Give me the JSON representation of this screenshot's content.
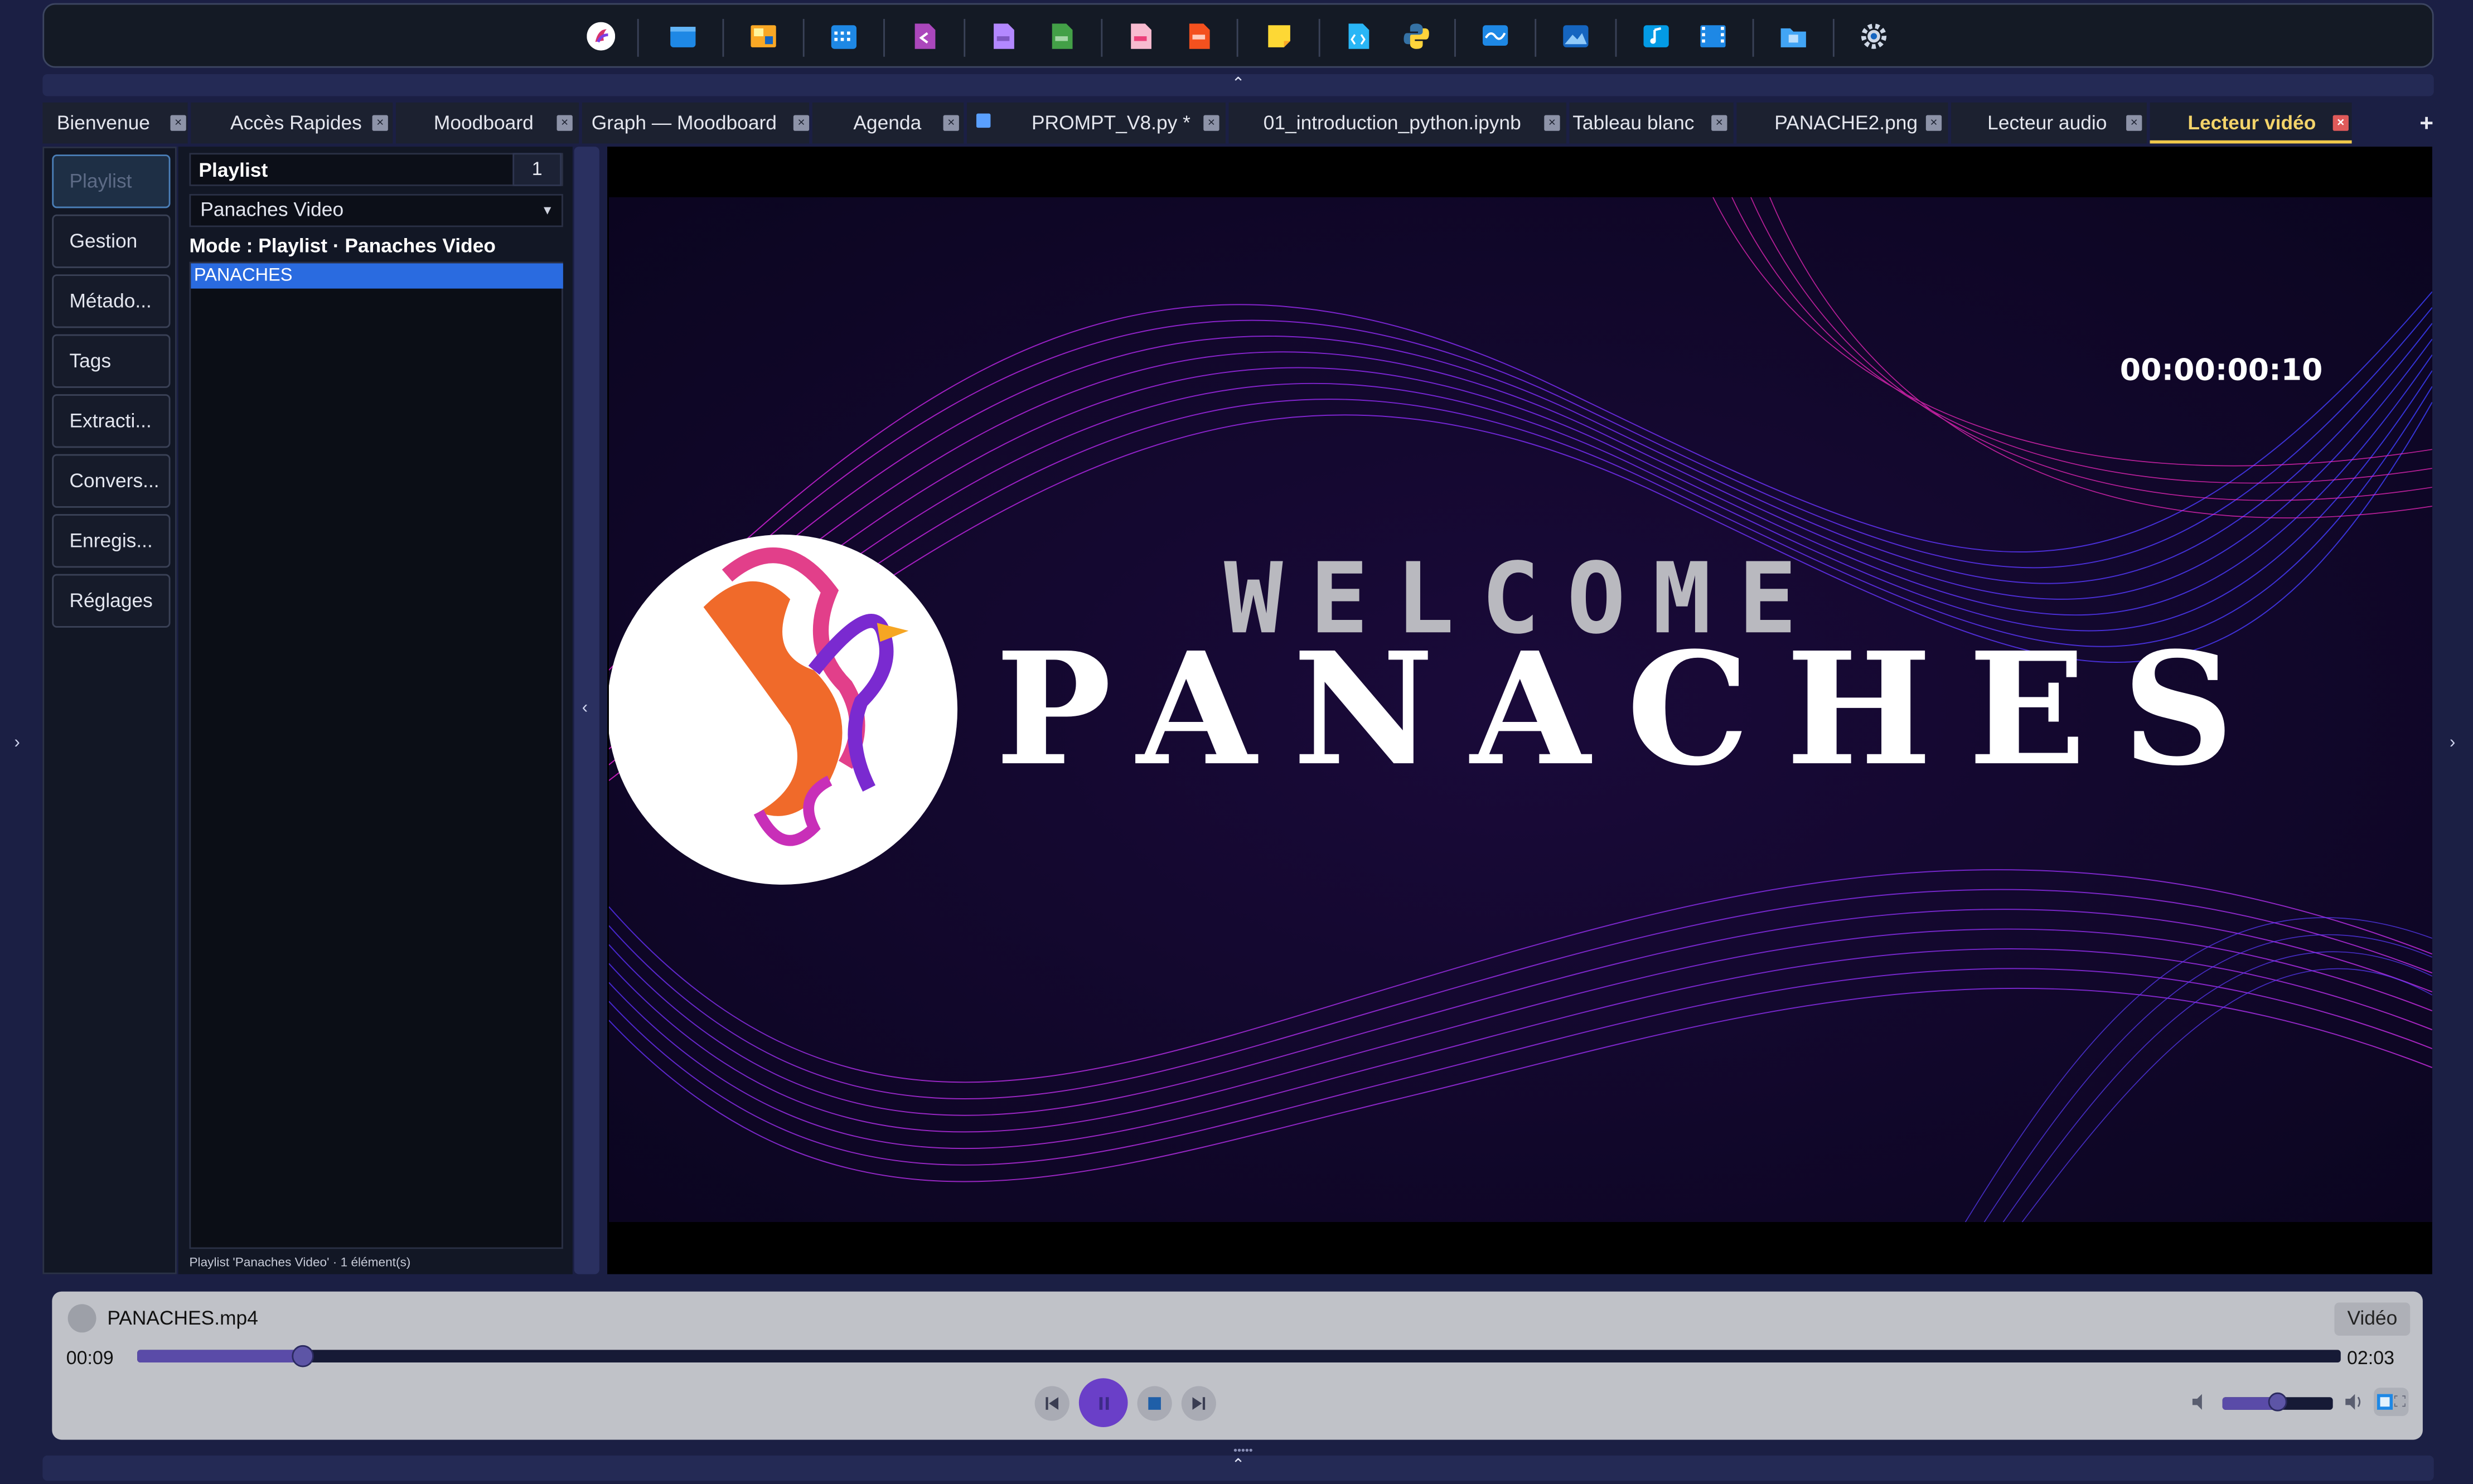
{
  "tabs": [
    {
      "label": "Bienvenue"
    },
    {
      "label": "Accès Rapides"
    },
    {
      "label": "Moodboard"
    },
    {
      "label": "Graph — Moodboard"
    },
    {
      "label": "Agenda"
    },
    {
      "label": "PROMPT_V8.py *"
    },
    {
      "label": "01_introduction_python.ipynb"
    },
    {
      "label": "Tableau blanc"
    },
    {
      "label": "PANACHE2.png"
    },
    {
      "label": "Lecteur audio"
    },
    {
      "label": "Lecteur vidéo"
    }
  ],
  "tab_add_label": "+",
  "sidebar": {
    "items": [
      {
        "label": "Playlist"
      },
      {
        "label": "Gestion"
      },
      {
        "label": "Métado..."
      },
      {
        "label": "Tags"
      },
      {
        "label": "Extracti..."
      },
      {
        "label": "Convers..."
      },
      {
        "label": "Enregis..."
      },
      {
        "label": "Réglages"
      }
    ]
  },
  "playlist": {
    "title": "Playlist",
    "count": "1",
    "selected_playlist": "Panaches Video",
    "mode_text": "Mode : Playlist · Panaches Video",
    "items": [
      "PANACHES"
    ],
    "status": "Playlist 'Panaches Video' · 1 élément(s)"
  },
  "video": {
    "timecode": "00:00:00:10",
    "welcome_text": "WELCOME",
    "brand_text": "PANACHES"
  },
  "player": {
    "file_name": "PANACHES.mp4",
    "mode_badge": "Vidéo",
    "current_time": "00:09",
    "total_time": "02:03",
    "progress_fraction": 0.075,
    "volume_fraction": 0.5
  },
  "colors": {
    "accent": "#6a3fc8",
    "active_tab": "#f0c94c",
    "selection": "#2a6be0"
  }
}
